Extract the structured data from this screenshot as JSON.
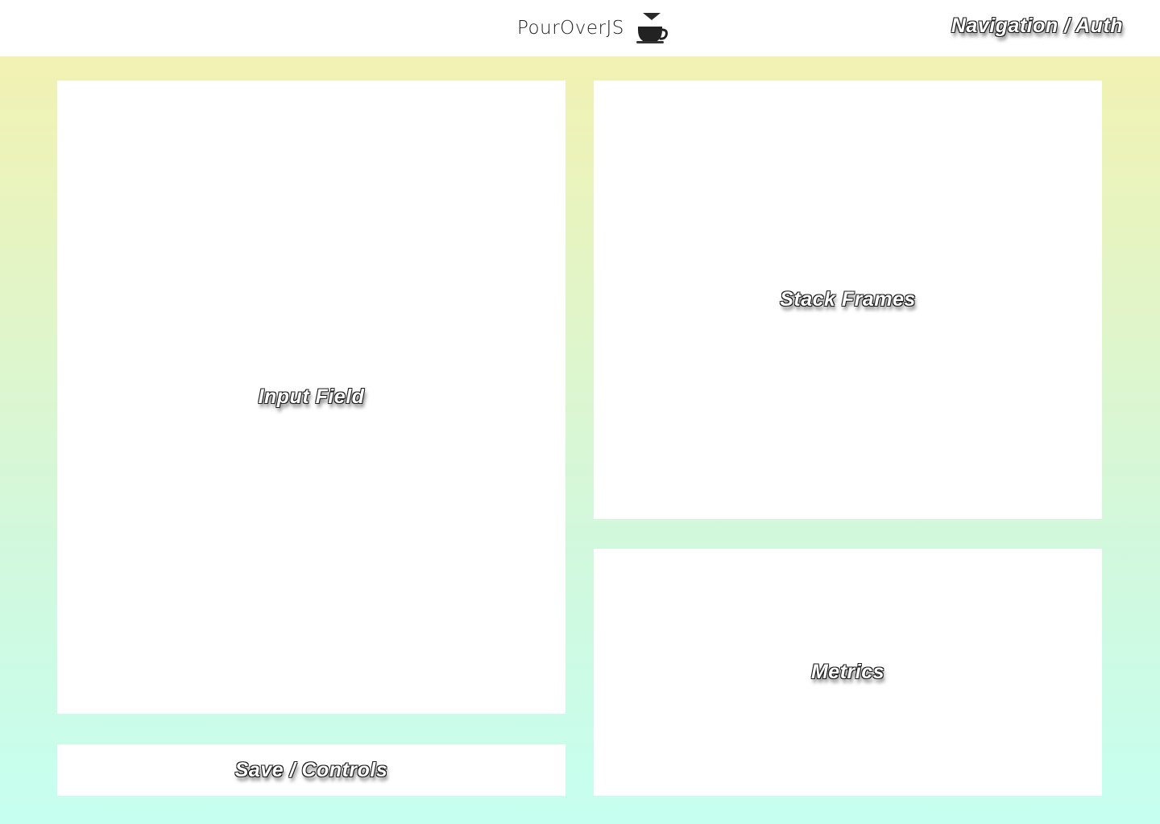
{
  "header": {
    "brand_name": "PourOverJS",
    "logo_icon": "pour-over-coffee-cup-icon",
    "nav_label": "Navigation / Auth"
  },
  "panels": {
    "input_label": "Input Field",
    "save_label": "Save / Controls",
    "stack_label": "Stack Frames",
    "metrics_label": "Metrics"
  },
  "colors": {
    "gradient_top": "#f2f2b2",
    "gradient_bottom": "#c6fff0",
    "panel": "#ffffff",
    "label_outline": "#1a1a1a"
  }
}
